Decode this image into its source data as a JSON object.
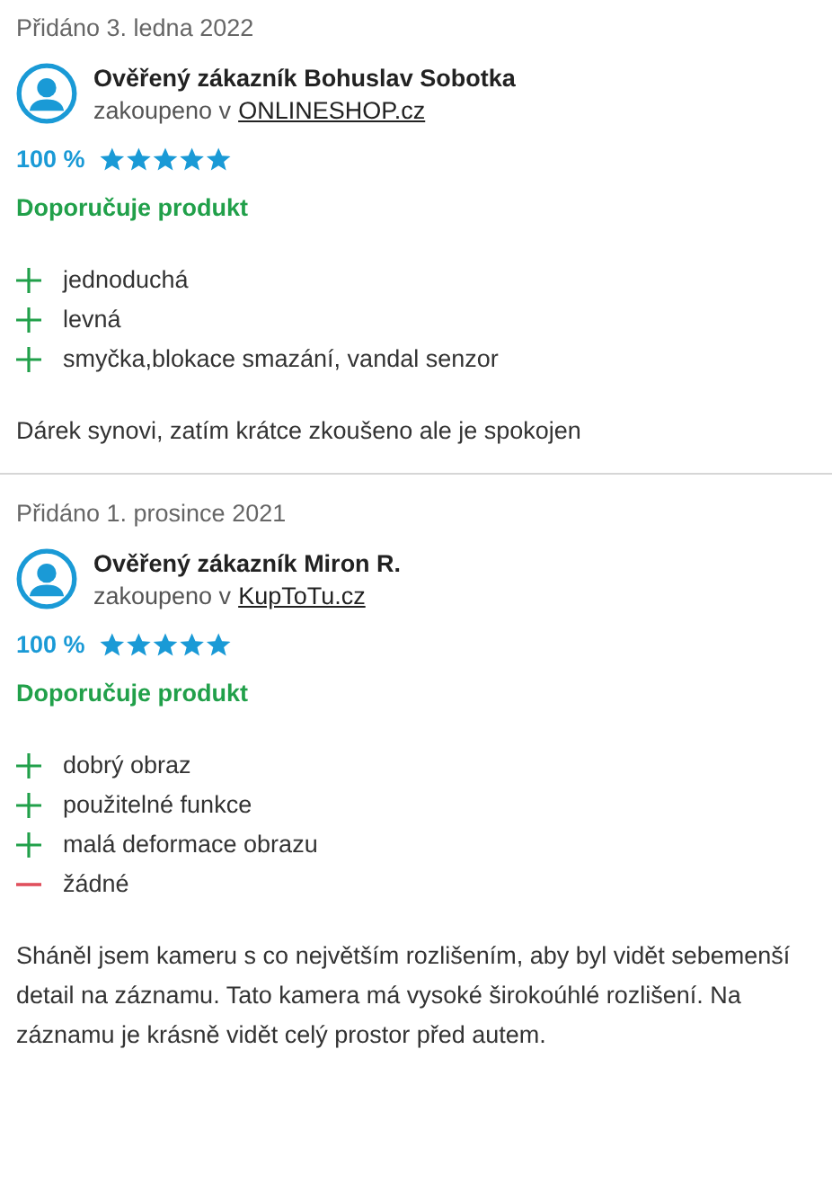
{
  "reviews": [
    {
      "date": "Přidáno 3. ledna 2022",
      "author": "Ověřený zákazník Bohuslav Sobotka",
      "purchased_prefix": "zakoupeno v",
      "shop": "ONLINESHOP.cz",
      "rating": "100 %",
      "stars": 5,
      "recommends": "Doporučuje produkt",
      "points": [
        {
          "kind": "pro",
          "text": "jednoduchá"
        },
        {
          "kind": "pro",
          "text": "levná"
        },
        {
          "kind": "pro",
          "text": "smyčka,blokace smazání, vandal senzor"
        }
      ],
      "text": "Dárek synovi, zatím krátce zkoušeno ale je spokojen"
    },
    {
      "date": "Přidáno 1. prosince 2021",
      "author": "Ověřený zákazník Miron R.",
      "purchased_prefix": "zakoupeno v",
      "shop": "KupToTu.cz",
      "rating": "100 %",
      "stars": 5,
      "recommends": "Doporučuje produkt",
      "points": [
        {
          "kind": "pro",
          "text": "dobrý obraz"
        },
        {
          "kind": "pro",
          "text": "použitelné funkce"
        },
        {
          "kind": "pro",
          "text": "malá deformace obrazu"
        },
        {
          "kind": "con",
          "text": "žádné"
        }
      ],
      "text": "Sháněl jsem kameru s co největším rozlišením, aby byl vidět sebemenší detail na záznamu. Tato kamera má vysoké širokoúhlé rozlišení. Na záznamu je krásně vidět celý prostor před autem."
    }
  ]
}
